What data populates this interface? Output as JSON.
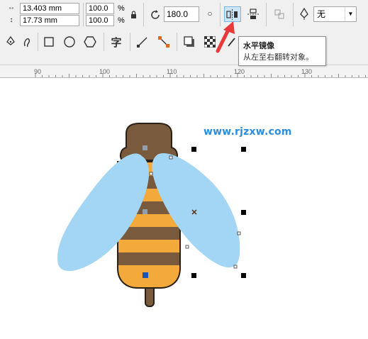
{
  "toolbar": {
    "width_value": "13.403 mm",
    "height_value": "17.73 mm",
    "scale_x": "100.0",
    "scale_y": "100.0",
    "percent_x": "%",
    "percent_y": "%",
    "rotation": "180.0",
    "outline_select": "无"
  },
  "tooltip": {
    "title": "水平镜像",
    "description": "从左至右翻转对象。"
  },
  "tools": {
    "text_tool": "字"
  },
  "ruler": {
    "labels": [
      "90",
      "100",
      "110",
      "120",
      "130"
    ]
  },
  "watermark": "www.rjzxw.com",
  "colors": {
    "bee_brown": "#7a5a3c",
    "bee_orange": "#f4a93b",
    "wing_blue": "#a3d6f4",
    "accent_red": "#e83a3a",
    "highlight_blue": "#2a8ee0"
  }
}
